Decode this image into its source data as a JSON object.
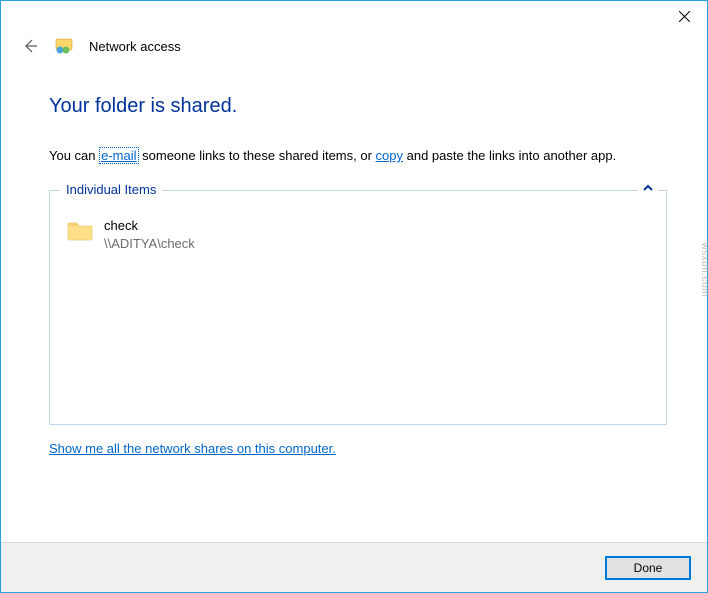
{
  "window": {
    "title": "Network access"
  },
  "heading": "Your folder is shared.",
  "instruction": {
    "part1": "You can ",
    "link1": "e-mail",
    "part2": " someone links to these shared items, or ",
    "link2": "copy",
    "part3": " and paste the links into another app."
  },
  "group": {
    "legend": "Individual Items",
    "items": [
      {
        "name": "check",
        "path": "\\\\ADITYA\\check"
      }
    ]
  },
  "show_all_link": "Show me all the network shares on this computer.",
  "footer": {
    "done": "Done"
  },
  "watermark": "wsxdn.com"
}
